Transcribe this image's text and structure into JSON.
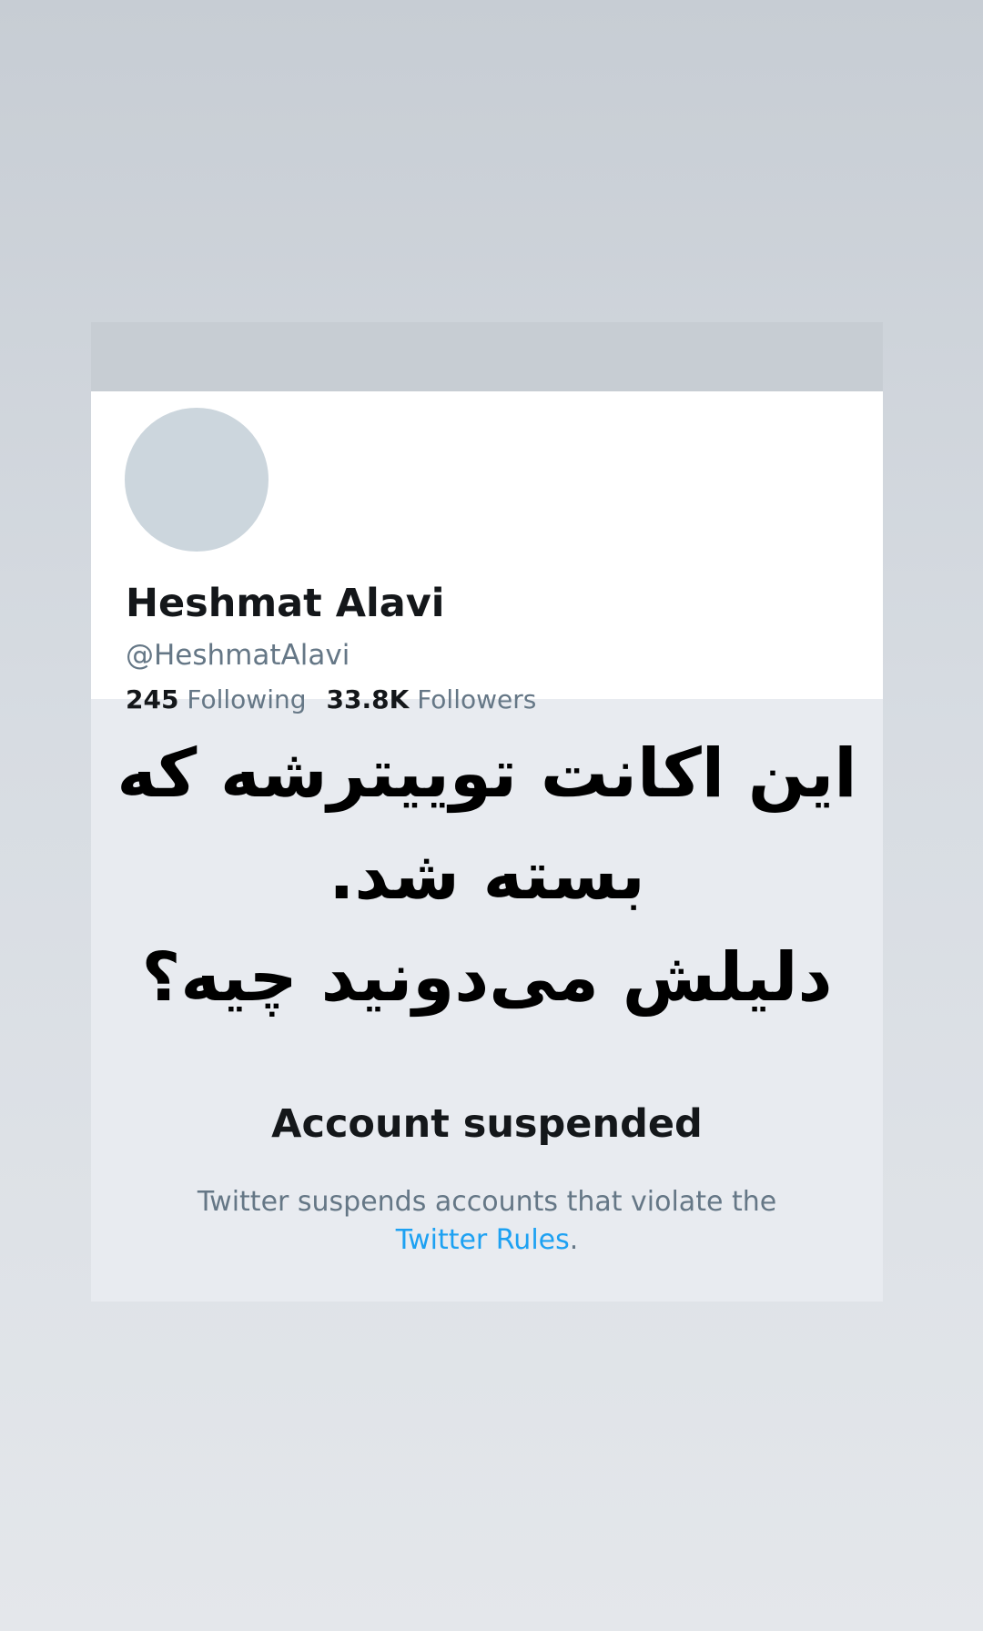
{
  "profile": {
    "display_name": "Heshmat Alavi",
    "handle": "@HeshmatAlavi",
    "following_count": "245",
    "following_label": "Following",
    "followers_count": "33.8K",
    "followers_label": "Followers"
  },
  "overlay": {
    "line1": "این اکانت توییترشه که",
    "line2": "بسته شد.",
    "line3": "دلیلش می‌دونید چیه؟"
  },
  "suspension": {
    "title": "Account suspended",
    "description": "Twitter suspends accounts that violate the",
    "link_text": "Twitter Rules",
    "link_suffix": "."
  },
  "colors": {
    "link_blue": "#1da1f2",
    "text_primary": "#14171a",
    "text_secondary": "#657786",
    "banner_gray": "#c7cdd3",
    "avatar_gray": "#ccd6dd"
  }
}
